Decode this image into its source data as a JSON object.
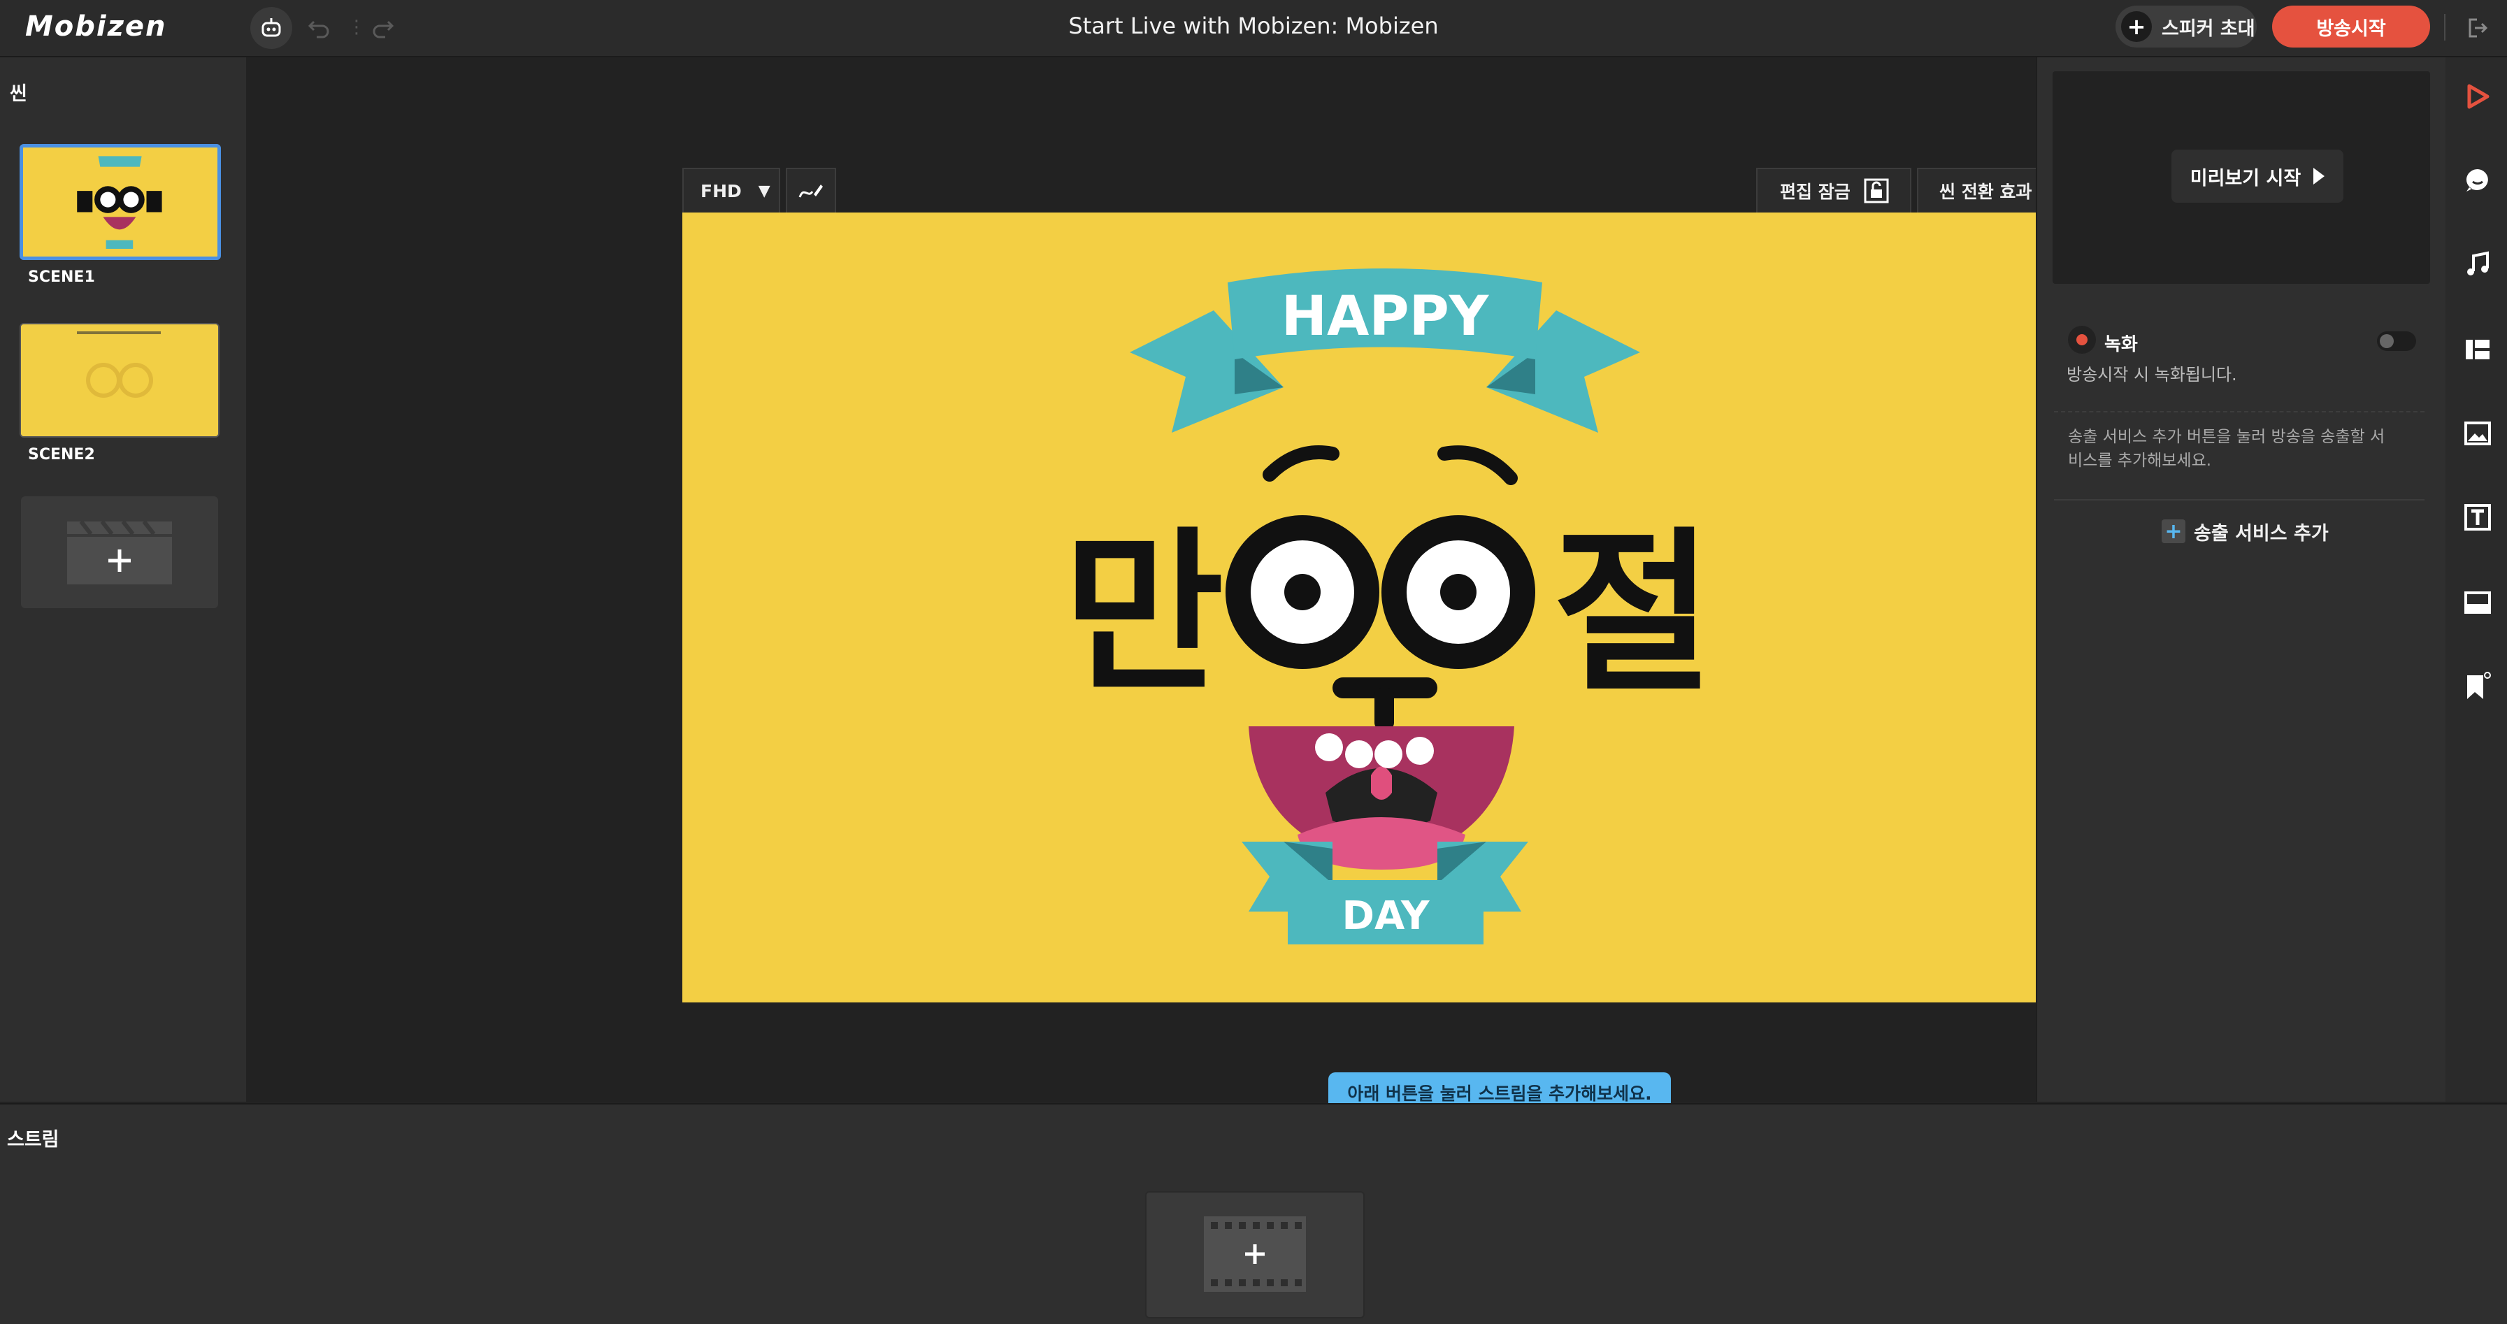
{
  "app": {
    "logo_text": "Mobizen",
    "window_title": "Start Live with Mobizen: Mobizen"
  },
  "toolbar": {
    "robot_icon": "robot-icon",
    "undo_icon": "undo-icon",
    "redo_icon": "redo-icon",
    "invite_speaker_label": "스피커 초대",
    "broadcast_start_label": "방송시작",
    "exit_icon": "exit-icon"
  },
  "scenes": {
    "title": "씬",
    "items": [
      {
        "label": "SCENE1",
        "selected": true
      },
      {
        "label": "SCENE2",
        "selected": false
      }
    ],
    "add_icon": "add-scene-icon"
  },
  "canvas": {
    "resolution_label": "FHD",
    "edit_lock_label": "편집 잠금",
    "scene_transition_label": "씬 전환 효과",
    "artwork_text": {
      "top_banner": "HAPPY",
      "left_char": "만",
      "right_char": "절",
      "bottom_banner": "DAY"
    },
    "hint_text": "아래 버튼을 눌러 스트림을 추가해보세요."
  },
  "right_panel": {
    "preview_button_label": "미리보기 시작",
    "recording_label": "녹화",
    "recording_on": false,
    "recording_desc": "방송시작 시 녹화됩니다.",
    "service_desc": "송출 서비스 추가 버튼을 눌러 방송을 송출할 서비스를 추가해보세요.",
    "add_service_label": "송출 서비스 추가"
  },
  "icon_strip": [
    "play-icon",
    "chat-icon",
    "music-icon",
    "layout-icon",
    "image-icon",
    "text-icon",
    "caption-icon",
    "bookmark-icon"
  ],
  "stream": {
    "title": "스트림",
    "add_icon": "add-stream-icon"
  },
  "colors": {
    "accent_red": "#e5523f",
    "hint_blue": "#58b7f0",
    "stage_yellow": "#f3cf44",
    "banner_teal": "#4db8be",
    "selection_blue": "#4a90e2"
  }
}
